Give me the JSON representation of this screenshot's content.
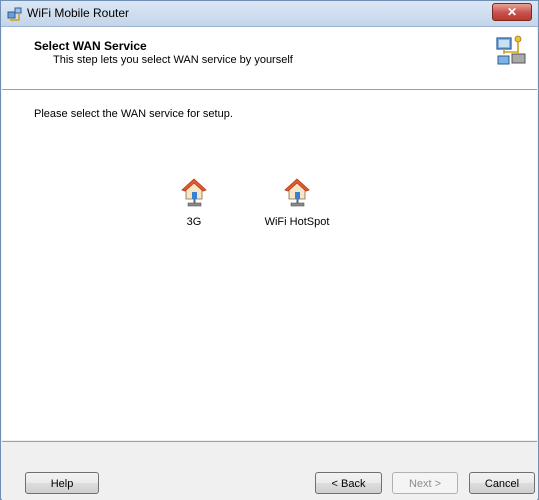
{
  "window": {
    "title": "WiFi Mobile Router",
    "close_label": "✕"
  },
  "header": {
    "title": "Select WAN Service",
    "subtitle": "This step lets you select WAN service by yourself"
  },
  "content": {
    "prompt": "Please select the WAN service for setup.",
    "services": [
      {
        "label": "3G",
        "icon": "house-network-icon"
      },
      {
        "label": "WiFi HotSpot",
        "icon": "house-network-icon"
      }
    ]
  },
  "footer": {
    "help": "Help",
    "back": "< Back",
    "next": "Next >",
    "cancel": "Cancel",
    "next_enabled": false
  },
  "colors": {
    "header_bg": "#ffffff",
    "window_bg": "#f0f0f0",
    "house_roof": "#e85a2a",
    "house_wall": "#f4e6c6"
  }
}
